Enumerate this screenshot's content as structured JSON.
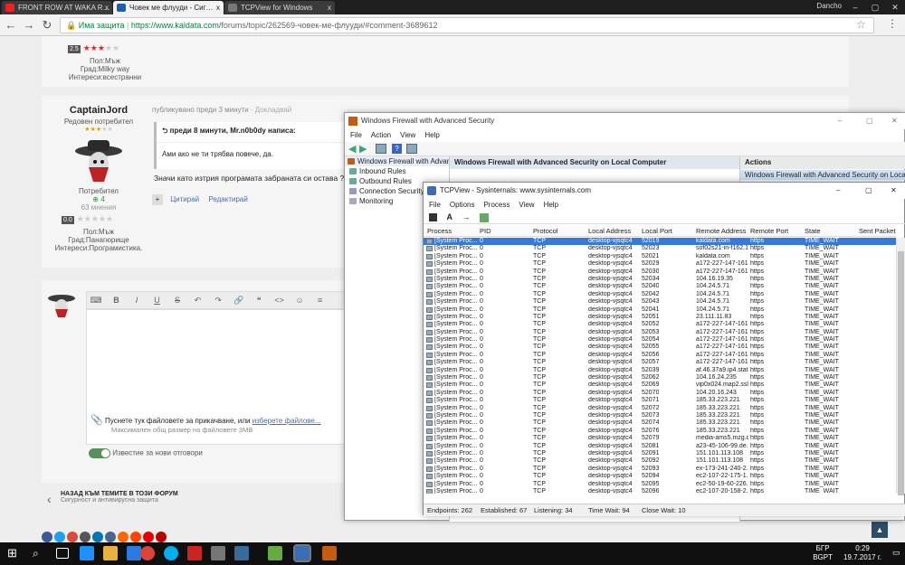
{
  "browser": {
    "tabs": [
      {
        "label": "FRONT ROW AT WAKA R…",
        "x": "x"
      },
      {
        "label": "Човек ме флууди - Сиг…",
        "x": "x"
      },
      {
        "label": "TCPView for Windows",
        "x": "x"
      }
    ],
    "user": "Dancho",
    "security_label": "Има защита",
    "url_host": "https://www.kaldata.com",
    "url_path": "/forums/topic/262569-човек-ме-флууди/#comment-3689612"
  },
  "forum": {
    "top_user": {
      "rating": "2.5",
      "gender": "Пол:Мъж",
      "city": "Град:Milky way",
      "interests": "Интереси:всестранни"
    },
    "post": {
      "author": "CaptainJord",
      "role": "Редовен потребител",
      "posted": "публикувано преди 3 минути",
      "report": "Докладвай",
      "group": "Потребител",
      "rep": "4",
      "posts": "63 мнения",
      "rating": "0.0",
      "gender": "Пол:Мъж",
      "city": "Град:Панагюрище",
      "interests": "Интереси:Програмистика.",
      "quote_header": "преди 8 минути, Mr.n0b0dy написа:",
      "quote_text": "Ами ако не ти трябва повече, да.",
      "body": "Значи като изтрия програмата забраната си остава ?",
      "quote_btn": "Цитирай",
      "reply_btn": "Редактирай"
    },
    "editor": {
      "buttons": [
        "B",
        "I",
        "U",
        "S",
        "↶",
        "↷",
        "🔗",
        "❝",
        "<>",
        "☺",
        "≡",
        "⋮"
      ],
      "attach_text": "Пуснете тук файловете за прикачване, или",
      "attach_link": "изберете файлове...",
      "max_size": "Максимален общ размер на файловете 3MB",
      "notify": "Известие за нови отговори"
    },
    "back": {
      "title": "НАЗАД КЪМ ТЕМИТЕ В ТОЗИ ФОРУМ",
      "subtitle": "Сигурност и антивирусна защита"
    }
  },
  "firewall": {
    "title": "Windows Firewall with Advanced Security",
    "menu": [
      "File",
      "Action",
      "View",
      "Help"
    ],
    "tree": [
      "Windows Firewall with Advance",
      "Inbound Rules",
      "Outbound Rules",
      "Connection Security",
      "Monitoring"
    ],
    "mid_title": "Windows Firewall with Advanced Security on Local Computer",
    "actions_title": "Actions",
    "actions_item": "Windows Firewall with Advanced Security on Local..."
  },
  "tcpview": {
    "title": "TCPView - Sysinternals: www.sysinternals.com",
    "menu": [
      "File",
      "Options",
      "Process",
      "View",
      "Help"
    ],
    "toolbar": [
      "A",
      "→"
    ],
    "columns": [
      "Process",
      "PID",
      "Protocol",
      "Local Address",
      "Local Port",
      "Remote Address",
      "Remote Port",
      "State",
      "Sent Packets"
    ],
    "rows": [
      [
        "52019",
        "kaldata.com"
      ],
      [
        "52023",
        "sof02s21-in-f162.1..."
      ],
      [
        "52021",
        "kaldata.com"
      ],
      [
        "52029",
        "a172-227-147-161..."
      ],
      [
        "52030",
        "a172-227-147-161..."
      ],
      [
        "52034",
        "104.16.19.35"
      ],
      [
        "52040",
        "104.24.5.71"
      ],
      [
        "52042",
        "104.24.5.71"
      ],
      [
        "52043",
        "104.24.5.71"
      ],
      [
        "52041",
        "104.24.5.71"
      ],
      [
        "52051",
        "23.111.11.83"
      ],
      [
        "52052",
        "a172-227-147-161..."
      ],
      [
        "52053",
        "a172-227-147-161..."
      ],
      [
        "52054",
        "a172-227-147-161..."
      ],
      [
        "52055",
        "a172-227-147-161..."
      ],
      [
        "52056",
        "a172-227-147-161..."
      ],
      [
        "52057",
        "a172-227-147-161..."
      ],
      [
        "52039",
        "af.46.37a9.ip4.stat..."
      ],
      [
        "52062",
        "104.16.24.235"
      ],
      [
        "52069",
        "vip0x024.map2.ssl..."
      ],
      [
        "52070",
        "104.20.16.243"
      ],
      [
        "52071",
        "185.33.223.221"
      ],
      [
        "52072",
        "185.33.223.221"
      ],
      [
        "52073",
        "185.33.223.221"
      ],
      [
        "52074",
        "185.33.223.221"
      ],
      [
        "52076",
        "185.33.223.221"
      ],
      [
        "52079",
        "media-ams5.mzg.d..."
      ],
      [
        "52081",
        "a23-45-106-99.de..."
      ],
      [
        "52091",
        "151.101.113.108"
      ],
      [
        "52092",
        "151.101.113.108"
      ],
      [
        "52093",
        "ex-173-241-240-2..."
      ],
      [
        "52094",
        "ec2-107-22-175-1..."
      ],
      [
        "52095",
        "ec2-50-19-60-226..."
      ],
      [
        "52096",
        "ec2-107-20-158-2..."
      ]
    ],
    "row_defaults": {
      "process": "[System Proc...",
      "pid": "0",
      "protocol": "TCP",
      "local_address": "desktop-vjsqtc4",
      "remote_port": "https",
      "state": "TIME_WAIT"
    },
    "status": {
      "endpoints": "Endpoints: 262",
      "established": "Established: 67",
      "listening": "Listening: 34",
      "time_wait": "Time Wait: 94",
      "close_wait": "Close Wait: 10"
    }
  },
  "taskbar": {
    "lang_top": "БГР",
    "lang_bottom": "BGPT",
    "time": "0:29",
    "date": "19.7.2017 г."
  },
  "colors": {
    "selection": "#3778d9",
    "forum_link": "#4a6ea9",
    "rating_star": "#cc3333"
  }
}
